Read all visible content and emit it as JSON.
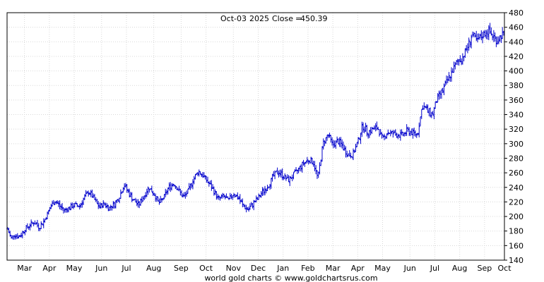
{
  "header": {
    "date": "Oct-03",
    "year": "2025",
    "close_label": "Close",
    "close_value": "450.39"
  },
  "footer": "world gold charts © www.goldchartsrus.com",
  "colors": {
    "bars": "#0000cc",
    "grid": "#d8d8d8",
    "frame": "#000000"
  },
  "chart_data": {
    "type": "ohlc",
    "ylim": [
      140,
      480
    ],
    "yticks": [
      140,
      160,
      180,
      200,
      220,
      240,
      260,
      280,
      300,
      320,
      340,
      360,
      380,
      400,
      420,
      440,
      460,
      480
    ],
    "xlim": [
      0,
      20
    ],
    "month_labels": [
      "Mar",
      "Apr",
      "May",
      "Jun",
      "Jul",
      "Aug",
      "Sep",
      "Oct",
      "Nov",
      "Dec",
      "Jan",
      "Feb",
      "Mar",
      "Apr",
      "May",
      "Jun",
      "Jul",
      "Aug",
      "Sep",
      "Oct"
    ],
    "month_positions": [
      0.7,
      1.7,
      2.7,
      3.8,
      4.8,
      5.9,
      7.0,
      8.0,
      9.1,
      10.1,
      11.1,
      12.1,
      13.1,
      14.1,
      15.1,
      16.2,
      17.2,
      18.2,
      19.2,
      20.0
    ],
    "path_x": [
      0.0,
      0.15,
      0.3,
      0.5,
      0.7,
      0.9,
      1.1,
      1.3,
      1.5,
      1.7,
      1.9,
      2.1,
      2.3,
      2.5,
      2.7,
      2.9,
      3.1,
      3.3,
      3.5,
      3.7,
      3.9,
      4.1,
      4.3,
      4.5,
      4.7,
      4.9,
      5.1,
      5.3,
      5.5,
      5.7,
      5.9,
      6.1,
      6.3,
      6.5,
      6.7,
      6.9,
      7.1,
      7.3,
      7.5,
      7.7,
      7.9,
      8.1,
      8.3,
      8.5,
      8.7,
      8.9,
      9.1,
      9.3,
      9.5,
      9.7,
      9.9,
      10.1,
      10.3,
      10.5,
      10.7,
      10.9,
      11.1,
      11.3,
      11.5,
      11.7,
      11.9,
      12.1,
      12.3,
      12.5,
      12.7,
      12.9,
      13.1,
      13.3,
      13.5,
      13.7,
      13.9,
      14.1,
      14.3,
      14.5,
      14.7,
      14.9,
      15.1,
      15.3,
      15.5,
      15.7,
      15.9,
      16.1,
      16.3,
      16.5,
      16.7,
      16.9,
      17.1,
      17.3,
      17.5,
      17.7,
      17.9,
      18.1,
      18.3,
      18.5,
      18.7,
      18.9,
      19.1,
      19.3,
      19.5,
      19.7,
      19.9,
      20.0
    ],
    "path_y": [
      185,
      170,
      175,
      172,
      182,
      188,
      192,
      185,
      195,
      210,
      222,
      215,
      208,
      212,
      216,
      214,
      226,
      234,
      224,
      213,
      218,
      212,
      216,
      226,
      244,
      232,
      222,
      216,
      228,
      240,
      232,
      218,
      226,
      240,
      246,
      236,
      226,
      236,
      252,
      262,
      256,
      246,
      236,
      224,
      228,
      222,
      232,
      226,
      214,
      210,
      218,
      225,
      235,
      242,
      255,
      262,
      256,
      250,
      256,
      264,
      272,
      278,
      276,
      252,
      300,
      312,
      298,
      304,
      296,
      285,
      285,
      302,
      325,
      316,
      320,
      322,
      306,
      316,
      314,
      312,
      312,
      318,
      315,
      313,
      352,
      346,
      340,
      362,
      372,
      386,
      400,
      412,
      418,
      432,
      450,
      440,
      448,
      455,
      450,
      442,
      450,
      450
    ]
  }
}
